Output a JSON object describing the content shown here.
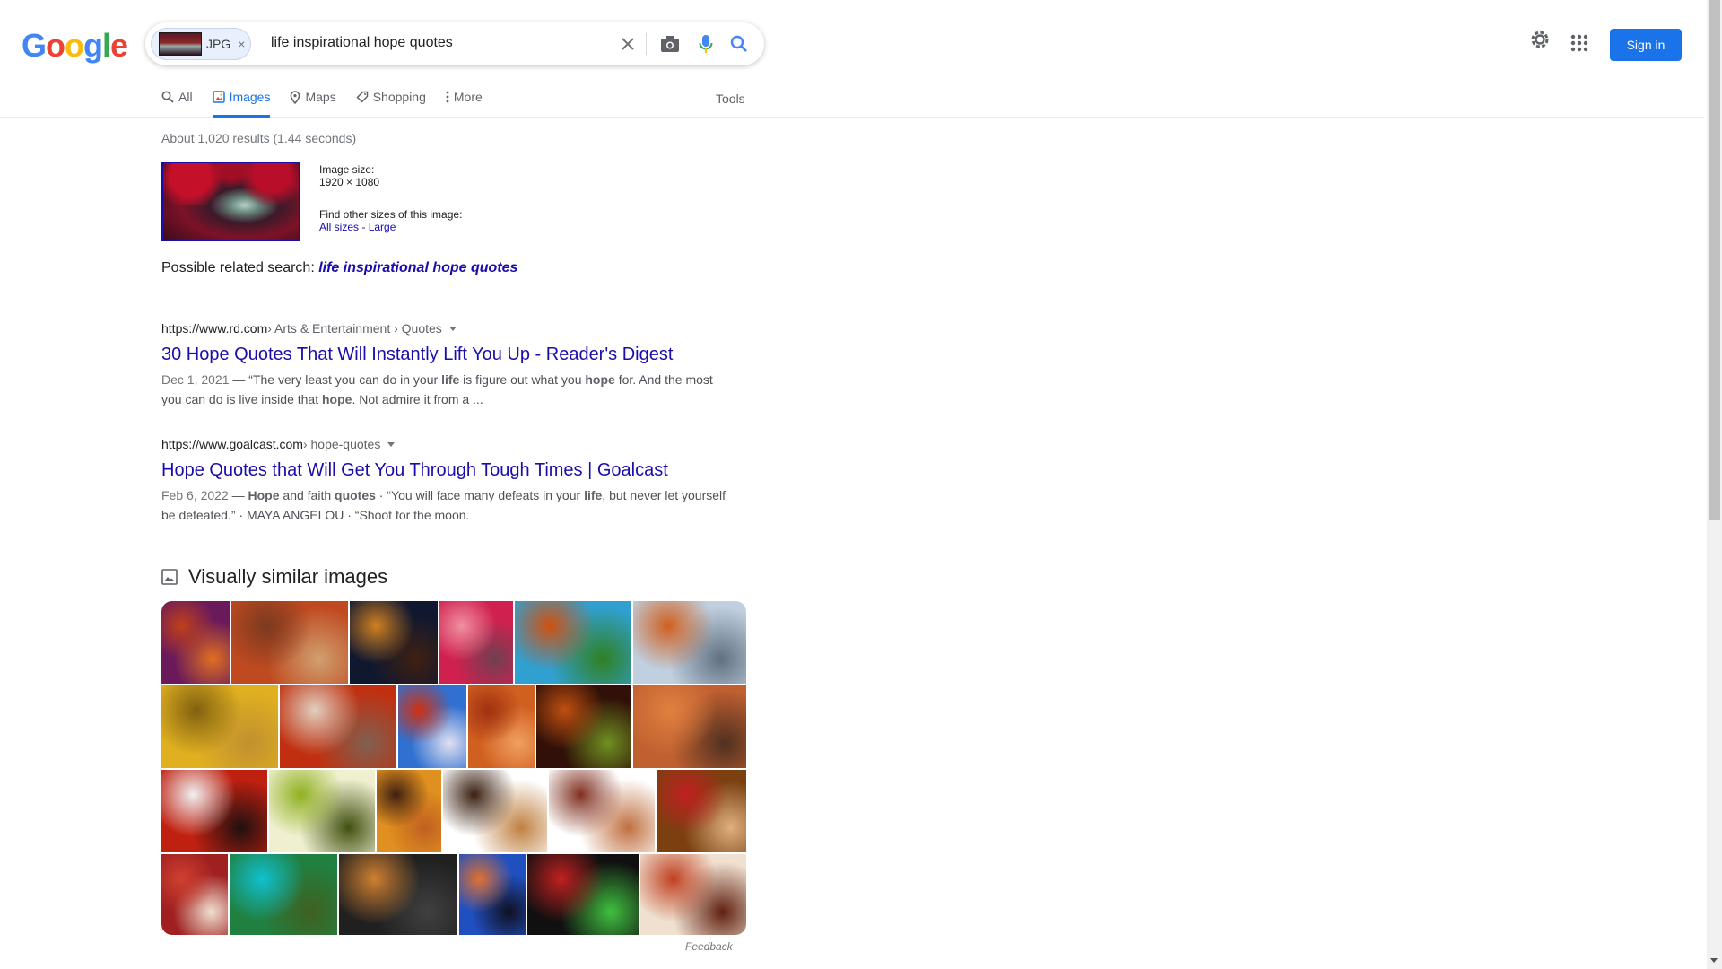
{
  "logo": {
    "letters": [
      "G",
      "o",
      "o",
      "g",
      "l",
      "e"
    ],
    "colors": [
      "#4285f4",
      "#ea4335",
      "#fbbc05",
      "#4285f4",
      "#34a853",
      "#ea4335"
    ]
  },
  "search": {
    "chip_label": "JPG",
    "chip_close": "×",
    "query": "life inspirational hope quotes"
  },
  "header": {
    "signin": "Sign in"
  },
  "tabs": [
    {
      "label": "All",
      "icon": "search-icon",
      "active": false
    },
    {
      "label": "Images",
      "icon": "image-icon",
      "active": true
    },
    {
      "label": "Maps",
      "icon": "map-pin-icon",
      "active": false
    },
    {
      "label": "Shopping",
      "icon": "tag-icon",
      "active": false
    },
    {
      "label": "More",
      "icon": "more-vert-icon",
      "active": false
    }
  ],
  "tools": "Tools",
  "stats": "About 1,020 results (1.44 seconds)",
  "image_info": {
    "size_label": "Image size:",
    "size_value": "1920 × 1080",
    "other_label": "Find other sizes of this image:",
    "all_sizes": "All sizes",
    "sep": " - ",
    "large": "Large"
  },
  "related": {
    "prefix": "Possible related search: ",
    "query": "life inspirational hope quotes"
  },
  "results": [
    {
      "site": "https://www.rd.com",
      "crumbs": " › Arts & Entertainment › Quotes",
      "title": "30 Hope Quotes That Will Instantly Lift You Up - Reader's Digest",
      "date": "Dec 1, 2021",
      "snippet_parts": [
        {
          "t": " — “The very least you can do in your ",
          "b": false
        },
        {
          "t": "life",
          "b": true
        },
        {
          "t": " is figure out what you ",
          "b": false
        },
        {
          "t": "hope",
          "b": true
        },
        {
          "t": " for. And the most you can do is live inside that ",
          "b": false
        },
        {
          "t": "hope",
          "b": true
        },
        {
          "t": ". Not admire it from a ...",
          "b": false
        }
      ]
    },
    {
      "site": "https://www.goalcast.com",
      "crumbs": " › hope-quotes",
      "title": "Hope Quotes that Will Get You Through Tough Times | Goalcast",
      "date": "Feb 6, 2022",
      "snippet_parts": [
        {
          "t": " — ",
          "b": false
        },
        {
          "t": "Hope",
          "b": true
        },
        {
          "t": " and faith ",
          "b": false
        },
        {
          "t": "quotes",
          "b": true
        },
        {
          "t": " · “You will face many defeats in your ",
          "b": false
        },
        {
          "t": "life",
          "b": true
        },
        {
          "t": ", but never let yourself be defeated.” · MAYA ANGELOU · “Shoot for the moon.",
          "b": false
        }
      ]
    }
  ],
  "visually_similar": {
    "heading": "Visually similar images",
    "tiles": [
      {
        "row": 0,
        "w": 76,
        "colors": [
          "#6a1a5a",
          "#c0401a",
          "#e07020"
        ]
      },
      {
        "row": 0,
        "w": 130,
        "colors": [
          "#c04a20",
          "#7a3a20",
          "#d0a070"
        ]
      },
      {
        "row": 0,
        "w": 98,
        "colors": [
          "#101830",
          "#d08020",
          "#402010"
        ]
      },
      {
        "row": 0,
        "w": 82,
        "colors": [
          "#d02050",
          "#f090a0",
          "#704050"
        ]
      },
      {
        "row": 0,
        "w": 130,
        "colors": [
          "#30a0d0",
          "#d05010",
          "#308020"
        ]
      },
      {
        "row": 0,
        "w": 130,
        "colors": [
          "#c0d0e0",
          "#d06020",
          "#607080"
        ]
      },
      {
        "row": 1,
        "w": 130,
        "colors": [
          "#e0b020",
          "#806010",
          "#c09030"
        ]
      },
      {
        "row": 1,
        "w": 130,
        "colors": [
          "#c03010",
          "#e0d0c0",
          "#806050"
        ]
      },
      {
        "row": 1,
        "w": 76,
        "colors": [
          "#3070d0",
          "#d03010",
          "#e0e0f0"
        ]
      },
      {
        "row": 1,
        "w": 74,
        "colors": [
          "#d06020",
          "#a03010",
          "#f0a060"
        ]
      },
      {
        "row": 1,
        "w": 106,
        "colors": [
          "#301008",
          "#c05010",
          "#709020"
        ]
      },
      {
        "row": 1,
        "w": 136,
        "colors": [
          "#c06030",
          "#e08040",
          "#503020"
        ]
      },
      {
        "row": 2,
        "w": 118,
        "colors": [
          "#c02010",
          "#f0f0f0",
          "#201010"
        ]
      },
      {
        "row": 2,
        "w": 118,
        "colors": [
          "#f0f0d0",
          "#90b020",
          "#405010"
        ]
      },
      {
        "row": 2,
        "w": 72,
        "colors": [
          "#e09020",
          "#402010",
          "#c06020"
        ]
      },
      {
        "row": 2,
        "w": 116,
        "colors": [
          "#ffffff",
          "#3a2010",
          "#c08040"
        ]
      },
      {
        "row": 2,
        "w": 118,
        "colors": [
          "#ffffff",
          "#803020",
          "#c07040"
        ]
      },
      {
        "row": 2,
        "w": 110,
        "colors": [
          "#7a4010",
          "#c02020",
          "#e0b080"
        ]
      },
      {
        "row": 3,
        "w": 74,
        "colors": [
          "#a02020",
          "#d04030",
          "#f0e0d0"
        ]
      },
      {
        "row": 3,
        "w": 120,
        "colors": [
          "#208040",
          "#10c0d0",
          "#406020"
        ]
      },
      {
        "row": 3,
        "w": 132,
        "colors": [
          "#202020",
          "#d08030",
          "#404040"
        ]
      },
      {
        "row": 3,
        "w": 74,
        "colors": [
          "#2050c0",
          "#e07030",
          "#101020"
        ]
      },
      {
        "row": 3,
        "w": 124,
        "colors": [
          "#101010",
          "#c02020",
          "#40c040"
        ]
      },
      {
        "row": 3,
        "w": 122,
        "colors": [
          "#f0e0d0",
          "#c04020",
          "#602010"
        ]
      }
    ]
  },
  "feedback": "Feedback"
}
